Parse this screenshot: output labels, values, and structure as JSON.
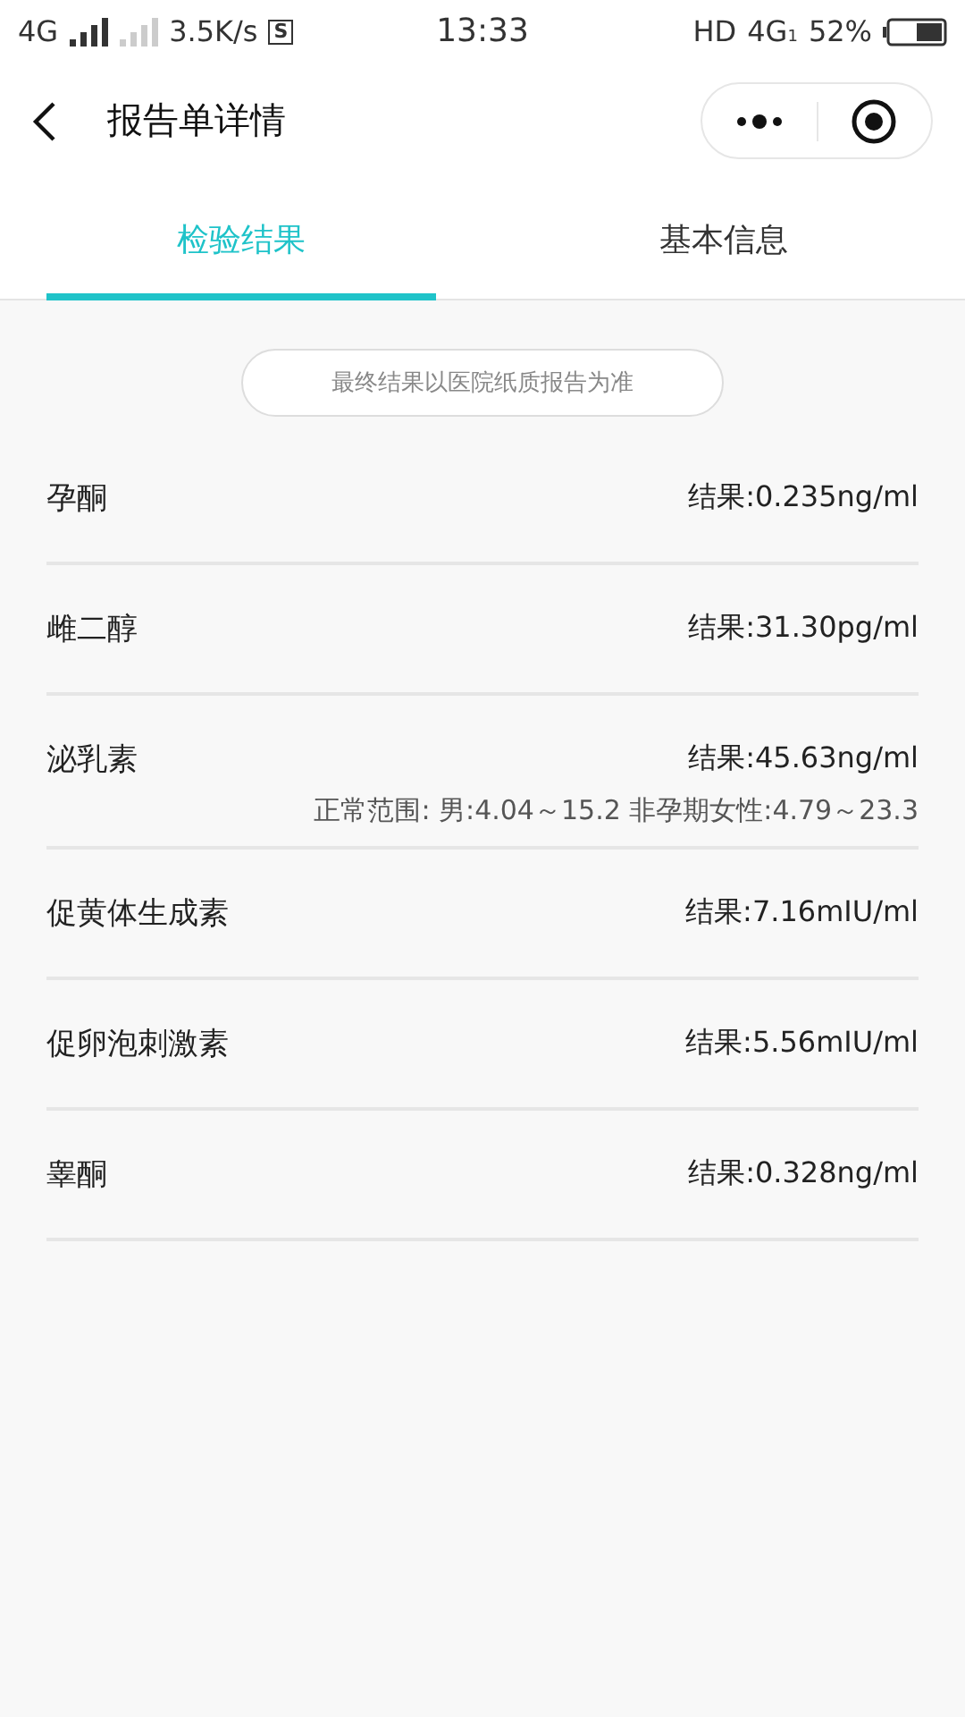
{
  "status_bar": {
    "network": "4G",
    "speed": "3.5K/s",
    "sim_badge": "S",
    "time": "13:33",
    "hd": "HD",
    "network_right": "4G",
    "network_right_sub": "1",
    "battery": "52%"
  },
  "header": {
    "title": "报告单详情"
  },
  "tabs": [
    {
      "label": "检验结果",
      "selected": true
    },
    {
      "label": "基本信息",
      "selected": false
    }
  ],
  "notice": "最终结果以医院纸质报告为准",
  "results": [
    {
      "name": "孕酮",
      "value": "结果:0.235ng/ml"
    },
    {
      "name": "雌二醇",
      "value": "结果:31.30pg/ml"
    },
    {
      "name": "泌乳素",
      "value": "结果:45.63ng/ml",
      "range": "正常范围: 男:4.04～15.2 非孕期女性:4.79～23.3"
    },
    {
      "name": "促黄体生成素",
      "value": "结果:7.16mIU/ml"
    },
    {
      "name": "促卵泡刺激素",
      "value": "结果:5.56mIU/ml"
    },
    {
      "name": "睾酮",
      "value": "结果:0.328ng/ml"
    }
  ]
}
